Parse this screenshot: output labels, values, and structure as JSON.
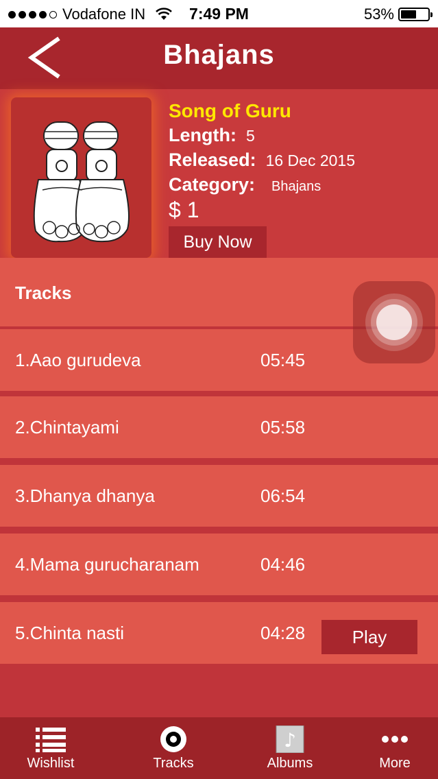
{
  "status_bar": {
    "carrier": "Vodafone IN",
    "time": "7:49 PM",
    "battery": "53%"
  },
  "nav": {
    "title": "Bhajans"
  },
  "album": {
    "title": "Song of Guru",
    "length_label": "Length:",
    "length_value": "5",
    "released_label": "Released:",
    "released_value": "16 Dec 2015",
    "category_label": "Category:",
    "category_value": "Bhajans",
    "price": "$ 1",
    "buy_label": "Buy Now"
  },
  "tracks": {
    "header": "Tracks",
    "items": [
      {
        "name": "1.Aao gurudeva",
        "duration": "05:45"
      },
      {
        "name": "2.Chintayami",
        "duration": "05:58"
      },
      {
        "name": "3.Dhanya dhanya",
        "duration": "06:54"
      },
      {
        "name": "4.Mama gurucharanam",
        "duration": "04:46"
      },
      {
        "name": "5.Chinta nasti",
        "duration": "04:28"
      }
    ],
    "play_label": "Play"
  },
  "tab_bar": {
    "items": [
      {
        "label": "Wishlist",
        "icon": "list-icon"
      },
      {
        "label": "Tracks",
        "icon": "disc-icon"
      },
      {
        "label": "Albums",
        "icon": "music-note-icon"
      },
      {
        "label": "More",
        "icon": "ellipsis-icon"
      }
    ]
  }
}
